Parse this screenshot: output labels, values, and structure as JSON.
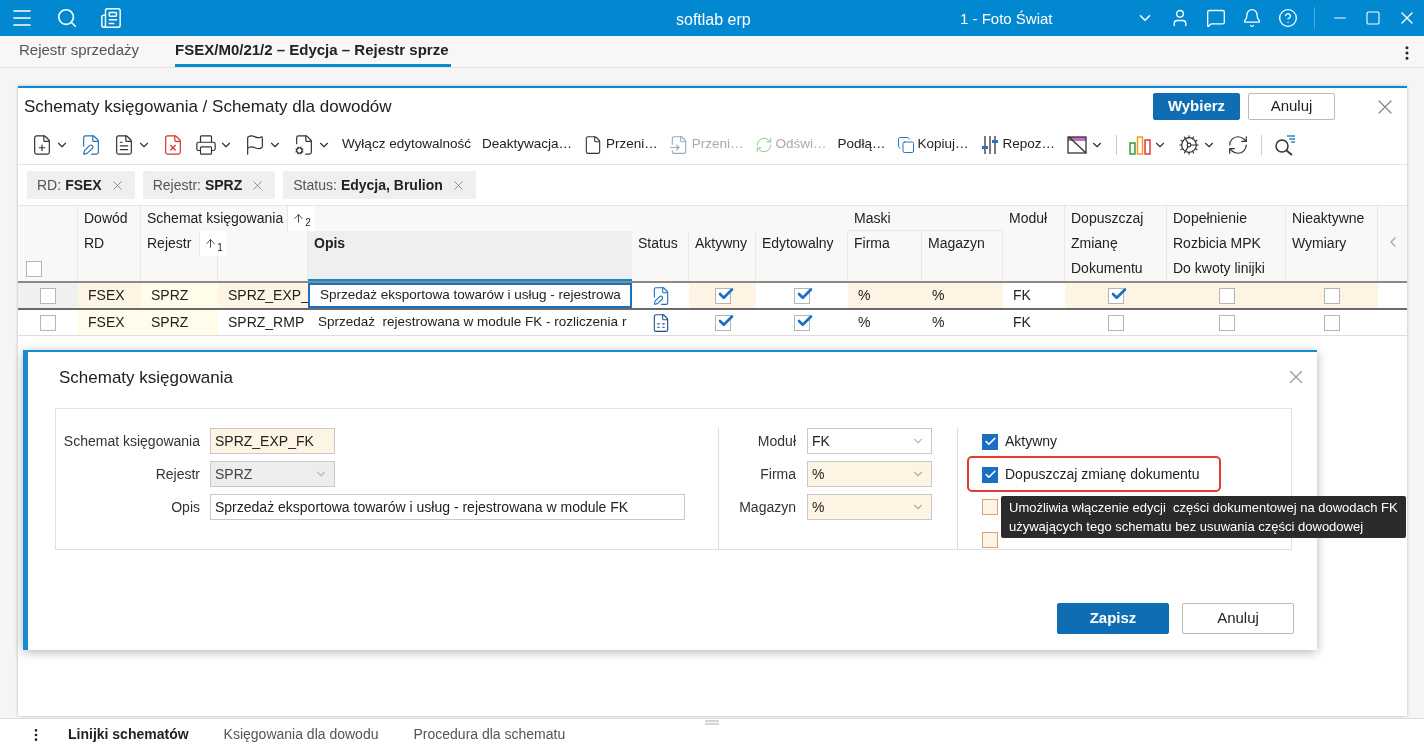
{
  "top_bar": {
    "title": "softlab erp",
    "company": "1 - Foto Świat"
  },
  "tabs": [
    {
      "label": "Rejestr sprzedaży",
      "selected": false
    },
    {
      "label": "FSEX/M0/21/2 – Edycja – Rejestr sprze",
      "selected": true
    }
  ],
  "panel": {
    "title": "Schematy księgowania / Schematy dla dowodów",
    "buttons": [
      {
        "label": "Wybierz",
        "kind": "primary"
      },
      {
        "label": "Anuluj",
        "kind": "secondary"
      }
    ],
    "toolbar": [
      {
        "kind": "icon",
        "dropdown": true,
        "disabled": false
      },
      {
        "kind": "icon",
        "dropdown": false,
        "disabled": false
      },
      {
        "kind": "icon",
        "dropdown": true,
        "disabled": false
      },
      {
        "kind": "icon",
        "dropdown": false,
        "disabled": false
      },
      {
        "kind": "icon",
        "dropdown": true,
        "disabled": false
      },
      {
        "kind": "icon",
        "dropdown": true,
        "disabled": false
      },
      {
        "kind": "icon",
        "dropdown": true,
        "disabled": false
      },
      {
        "kind": "text",
        "label": "Wyłącz edytowalność",
        "disabled": false
      },
      {
        "kind": "text",
        "label": "Deaktywacja…",
        "disabled": false
      },
      {
        "kind": "text",
        "label": "Przeni…",
        "disabled": false
      },
      {
        "kind": "text",
        "label": "Przeni…",
        "disabled": true
      },
      {
        "kind": "text",
        "label": "Odświ…",
        "disabled": true
      },
      {
        "kind": "text",
        "label": "Podłą…",
        "disabled": false
      },
      {
        "kind": "text",
        "label": "Kopiuj…",
        "disabled": false
      },
      {
        "kind": "text",
        "label": "Repoz…",
        "disabled": false
      },
      {
        "kind": "icon",
        "dropdown": true,
        "disabled": false
      },
      {
        "kind": "separator"
      },
      {
        "kind": "icon",
        "dropdown": true,
        "disabled": false
      },
      {
        "kind": "icon",
        "dropdown": true,
        "disabled": false
      },
      {
        "kind": "icon",
        "dropdown": false,
        "disabled": false
      },
      {
        "kind": "separator"
      },
      {
        "kind": "icon",
        "dropdown": false,
        "disabled": false
      }
    ],
    "filters": [
      {
        "label": "RD:",
        "value": "FSEX"
      },
      {
        "label": "Rejestr:",
        "value": "SPRZ"
      },
      {
        "label": "Status:",
        "value": "Edycja, Brulion"
      }
    ]
  },
  "table": {
    "all_checked": false,
    "header": {
      "dowod": "Dowód\nRD",
      "schemat": "Schemat księgowania",
      "schemat_sort": "2",
      "rejestr": "Rejestr",
      "rejestr_sort": "1",
      "opis": "Opis",
      "status": "Status",
      "aktywny": "Aktywny",
      "edytowalny": "Edytowalny",
      "maski": "Maski",
      "firma": "Firma",
      "magazyn": "Magazyn",
      "modul": "Moduł",
      "dopuszczaj": "Dopuszczaj\nZmianę\nDokumentu",
      "dopelnienie": "Dopełnienie\nRozbicia MPK\nDo kwoty linijki",
      "nieaktywne": "Nieaktywne\nWymiary"
    },
    "rows": [
      {
        "selected": true,
        "checked": false,
        "rd": "FSEX",
        "rejestr": "SPRZ",
        "schemat": "SPRZ_EXP_",
        "opis": "Sprzedaż eksportowa towarów i usług - rejestrowa",
        "kind": "edit",
        "aktywny": true,
        "edytowalny": true,
        "firma": "%",
        "magazyn": "%",
        "modul": "FK",
        "dopuszczaj": true,
        "dopelnienie": false,
        "nieaktywne": false
      },
      {
        "selected": false,
        "checked": false,
        "rd": "FSEX",
        "rejestr": "SPRZ",
        "schemat": "SPRZ_RMP",
        "opis": "Sprzedaż  rejestrowana w module FK - rozliczenia r",
        "kind": "draft",
        "aktywny": true,
        "edytowalny": true,
        "firma": "%",
        "magazyn": "%",
        "modul": "FK",
        "dopuszczaj": false,
        "dopelnienie": false,
        "nieaktywne": false
      }
    ]
  },
  "dialog": {
    "title": "Schematy księgowania",
    "left_fields": [
      {
        "label": "Schemat księgowania",
        "value": "SPRZ_EXP_FK",
        "kind": "text",
        "required": true
      },
      {
        "label": "Rejestr",
        "value": "SPRZ",
        "kind": "select",
        "disabled": true
      },
      {
        "label": "Opis",
        "value": "Sprzedaż eksportowa towarów i usług - rejestrowana w module FK",
        "kind": "wide"
      }
    ],
    "mid_fields": [
      {
        "label": "Moduł",
        "value": "FK",
        "required": false
      },
      {
        "label": "Firma",
        "value": "%",
        "required": true
      },
      {
        "label": "Magazyn",
        "value": "%",
        "required": true
      }
    ],
    "checkboxes": [
      {
        "label": "Aktywny",
        "checked": true,
        "highlighted": false
      },
      {
        "label": "Dopuszczaj zmianę dokumentu",
        "checked": true,
        "highlighted": true
      },
      {
        "checked": false,
        "highlighted": false
      },
      {
        "checked": false,
        "highlighted": false
      }
    ],
    "buttons": [
      {
        "label": "Zapisz",
        "kind": "primary"
      },
      {
        "label": "Anuluj",
        "kind": "secondary"
      }
    ]
  },
  "tooltip": "Umożliwia włączenie edycji  części dokumentowej na dowodach FK\nużywających tego schematu bez usuwania części dowodowej",
  "bottom_tabs": [
    {
      "label": "Linijki schematów",
      "selected": true
    },
    {
      "label": "Księgowania dla dowodu",
      "selected": false
    },
    {
      "label": "Procedura dla schematu",
      "selected": false
    }
  ]
}
